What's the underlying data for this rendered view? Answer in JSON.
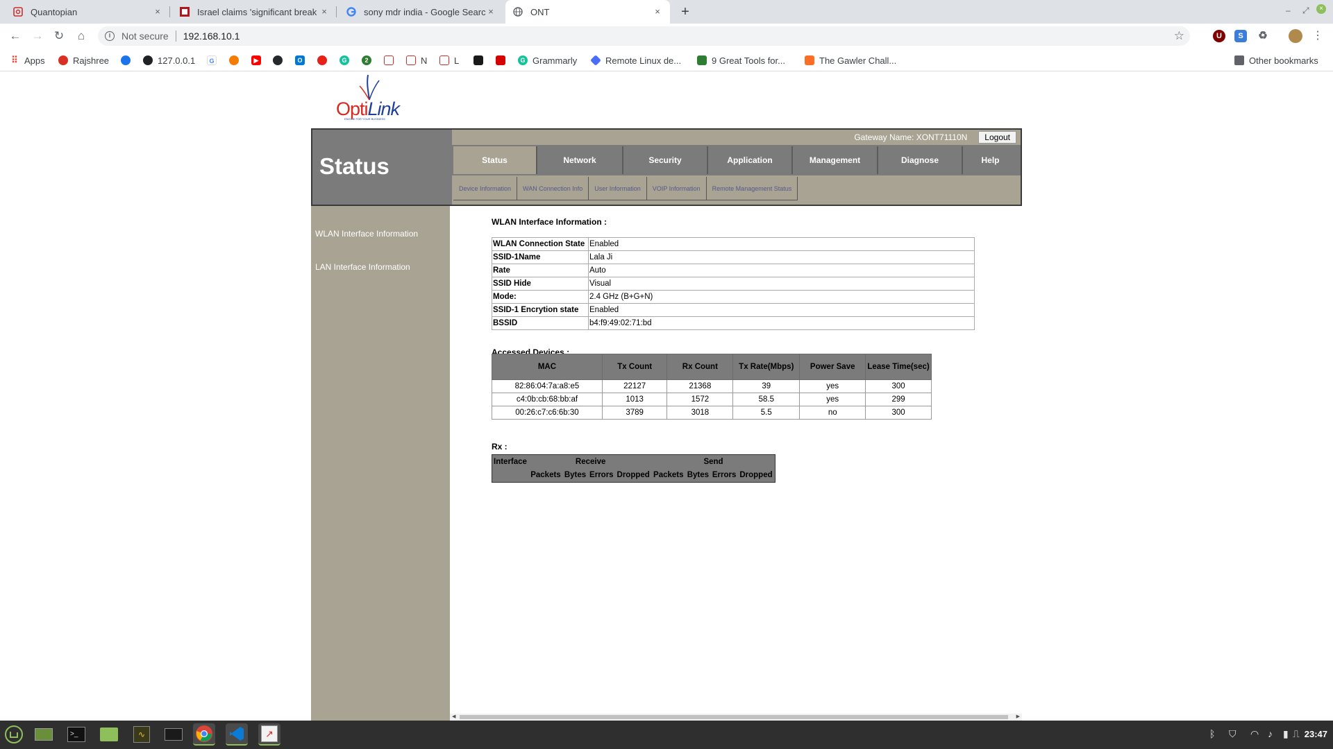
{
  "browser": {
    "tabs": [
      {
        "title": "Quantopian",
        "favicon_color": "#c8302a",
        "active": false
      },
      {
        "title": "Israel claims 'significant break",
        "favicon_color": "#b3151c",
        "active": false
      },
      {
        "title": "sony mdr india - Google Searc",
        "favicon_color": "#4285f4",
        "active": false
      },
      {
        "title": "ONT",
        "favicon_color": "#5f6368",
        "active": true
      }
    ],
    "close_glyph": "×",
    "new_tab_glyph": "+",
    "security_label": "Not secure",
    "url": "192.168.10.1",
    "bookmarks": [
      {
        "label": "Apps",
        "color": "#ea4335"
      },
      {
        "label": "Rajshree",
        "color": "#d93025"
      },
      {
        "label": "",
        "color": "#1a73e8"
      },
      {
        "label": "127.0.0.1",
        "color": "#202124"
      },
      {
        "label": "",
        "color": "#4285f4"
      },
      {
        "label": "",
        "color": "#f57c00"
      },
      {
        "label": "",
        "color": "#ff0000"
      },
      {
        "label": "",
        "color": "#24292e"
      },
      {
        "label": "",
        "color": "#0078d4"
      },
      {
        "label": "",
        "color": "#e62117"
      },
      {
        "label": "",
        "color": "#15c39a"
      },
      {
        "label": "",
        "color": "#2e7d32"
      },
      {
        "label": "",
        "color": "#c8302a"
      },
      {
        "label": "N",
        "color": "#c8302a"
      },
      {
        "label": "L",
        "color": "#c8302a"
      },
      {
        "label": "",
        "color": "#1a1a1a"
      },
      {
        "label": "",
        "color": "#d50000"
      },
      {
        "label": "Grammarly",
        "color": "#15c39a"
      },
      {
        "label": "Remote Linux de...",
        "color": "#4a6cf7"
      },
      {
        "label": "9 Great Tools for...",
        "color": "#2e7d32"
      },
      {
        "label": "The Gawler Chall...",
        "color": "#fc6d26"
      }
    ],
    "other_bookmarks": "Other bookmarks"
  },
  "page": {
    "logo": {
      "part1": "Opti",
      "part2": "Link",
      "tagline": "ENGINE FOR YOUR BUSINESS"
    },
    "section_title": "Status",
    "gateway_name": "Gateway Name: XONT71110N",
    "logout_label": "Logout",
    "main_tabs": [
      {
        "label": "Status",
        "active": true
      },
      {
        "label": "Network",
        "active": false
      },
      {
        "label": "Security",
        "active": false
      },
      {
        "label": "Application",
        "active": false
      },
      {
        "label": "Management",
        "active": false
      },
      {
        "label": "Diagnose",
        "active": false
      },
      {
        "label": "Help",
        "active": false
      }
    ],
    "sub_tabs": [
      "Device Information",
      "WAN Connection Info",
      "User Information",
      "VOIP Information",
      "Remote Management Status"
    ],
    "sidebar": [
      "WLAN Interface Information",
      "LAN Interface Information"
    ],
    "wlan": {
      "title": "WLAN Interface Information :",
      "rows": [
        {
          "key": "WLAN Connection State",
          "value": "Enabled"
        },
        {
          "key": "SSID-1Name",
          "value": "Lala Ji"
        },
        {
          "key": "Rate",
          "value": "Auto"
        },
        {
          "key": "SSID Hide",
          "value": "Visual"
        },
        {
          "key": "Mode:",
          "value": "2.4 GHz (B+G+N)"
        },
        {
          "key": "SSID-1 Encrytion state",
          "value": "Enabled"
        },
        {
          "key": "BSSID",
          "value": "b4:f9:49:02:71:bd"
        }
      ]
    },
    "devices": {
      "title": "Accessed Devices :",
      "headers": [
        "MAC",
        "Tx Count",
        "Rx Count",
        "Tx Rate(Mbps)",
        "Power Save",
        "Lease Time(sec)"
      ],
      "rows": [
        [
          "82:86:04:7a:a8:e5",
          "22127",
          "21368",
          "39",
          "yes",
          "300"
        ],
        [
          "c4:0b:cb:68:bb:af",
          "1013",
          "1572",
          "58.5",
          "yes",
          "299"
        ],
        [
          "00:26:c7:c6:6b:30",
          "3789",
          "3018",
          "5.5",
          "no",
          "300"
        ]
      ]
    },
    "rx": {
      "title": "Rx :",
      "interface": "Interface",
      "receive": "Receive",
      "send": "Send",
      "sub_headers": [
        "Packets",
        "Bytes",
        "Errors",
        "Dropped",
        "Packets",
        "Bytes",
        "Errors",
        "Dropped"
      ]
    }
  },
  "taskbar": {
    "clock": "23:47",
    "accent": "#8fbf5a"
  }
}
